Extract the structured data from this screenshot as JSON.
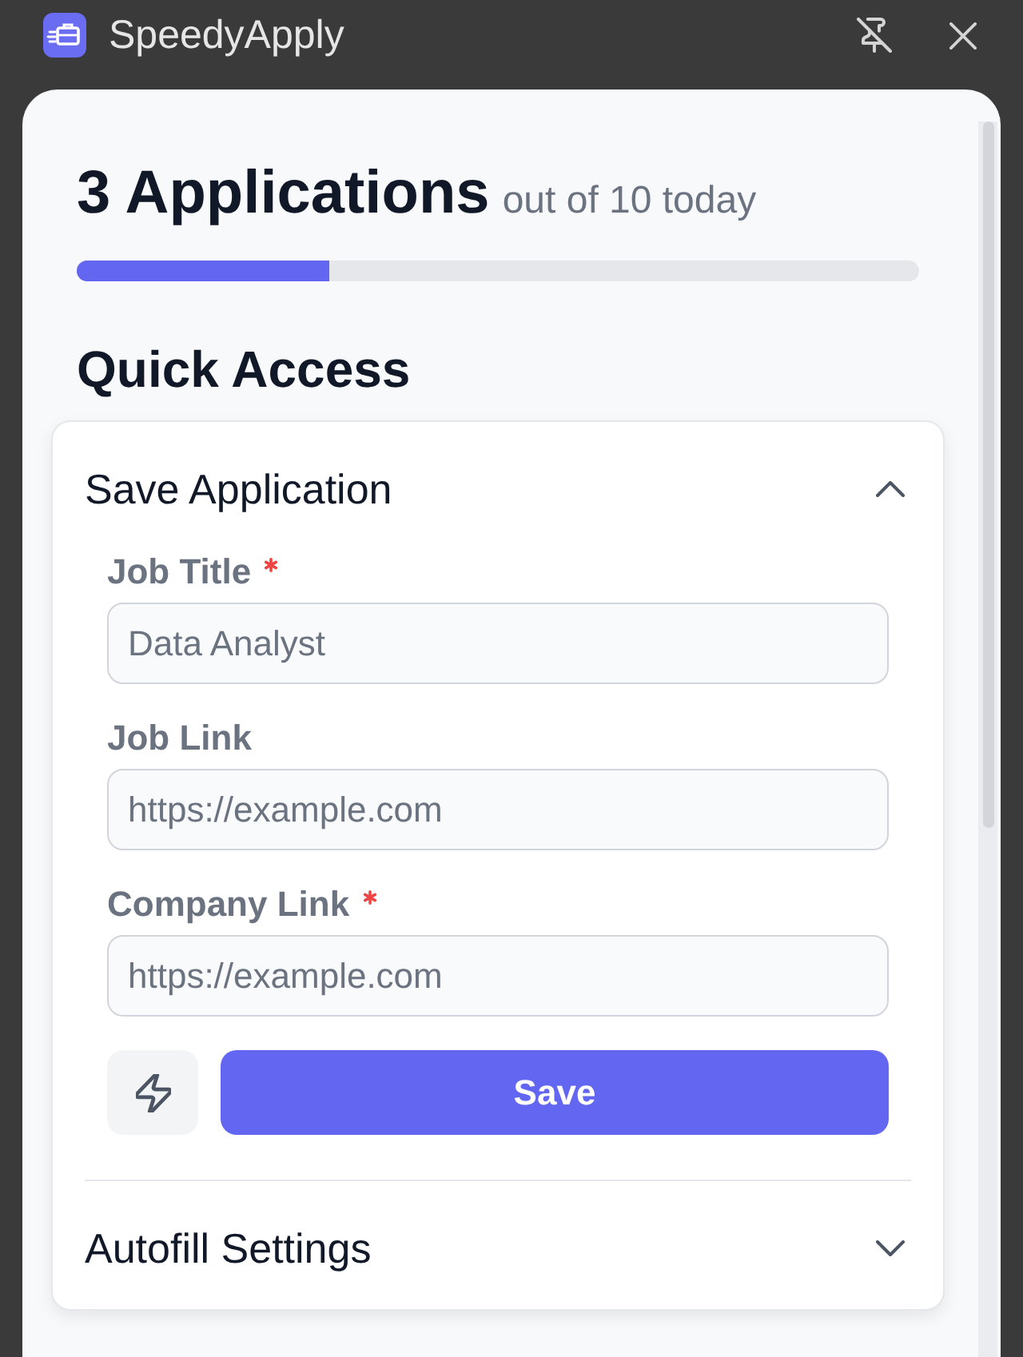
{
  "window": {
    "title": "SpeedyApply"
  },
  "summary": {
    "count": "3 Applications",
    "limit": "out of 10 today",
    "level": 0.3
  },
  "quick_access": {
    "title": "Quick Access",
    "sections": [
      {
        "title": "Save Application",
        "expanded": true,
        "fields": [
          {
            "label": "Job Title",
            "required": true,
            "placeholder": "Data Analyst"
          },
          {
            "label": "Job Link",
            "required": false,
            "placeholder": "https://example.com"
          },
          {
            "label": "Company Link",
            "required": true,
            "placeholder": "https://example.com"
          }
        ],
        "actions": [
          {
            "kind": "icon"
          },
          {
            "kind": "primary",
            "label": "Save"
          }
        ]
      },
      {
        "title": "Autofill Settings",
        "expanded": false
      }
    ]
  }
}
